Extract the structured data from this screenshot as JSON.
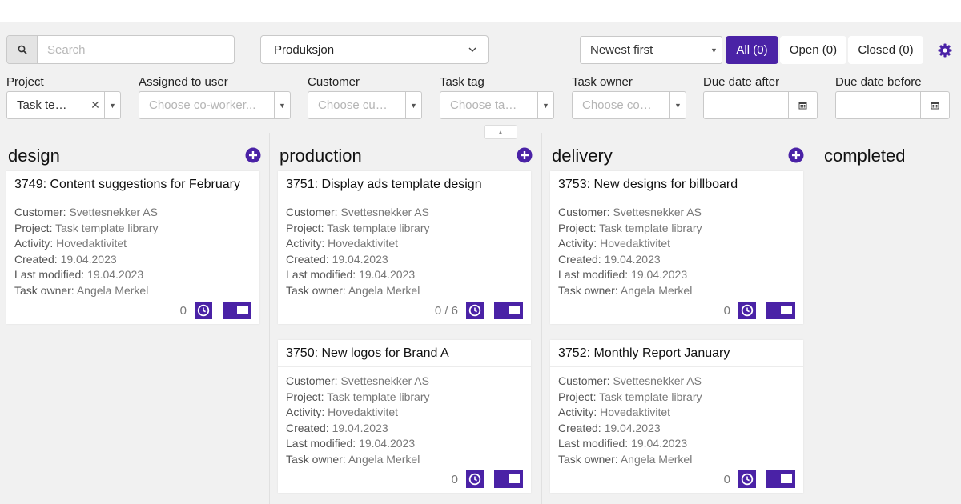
{
  "toolbar": {
    "search_placeholder": "Search",
    "board": "Produksjon",
    "sort": "Newest first",
    "filters": {
      "all": "All (0)",
      "open": "Open (0)",
      "closed": "Closed (0)"
    }
  },
  "filters": {
    "project": {
      "label": "Project",
      "value": "Task te…"
    },
    "assigned": {
      "label": "Assigned to user",
      "placeholder": "Choose co-worker..."
    },
    "customer": {
      "label": "Customer",
      "placeholder": "Choose cu…"
    },
    "task_tag": {
      "label": "Task tag",
      "placeholder": "Choose ta…"
    },
    "task_owner": {
      "label": "Task owner",
      "placeholder": "Choose co…"
    },
    "due_after": {
      "label": "Due date after"
    },
    "due_before": {
      "label": "Due date before"
    }
  },
  "meta_keys": {
    "customer": "Customer:",
    "project": "Project:",
    "activity": "Activity:",
    "created": "Created:",
    "modified": "Last modified:",
    "owner": "Task owner:"
  },
  "columns": [
    {
      "title": "design",
      "cards": [
        {
          "title": "3749: Content suggestions for February",
          "customer": "Svettesnekker AS",
          "project": "Task template library",
          "activity": "Hovedaktivitet",
          "created": "19.04.2023",
          "modified": "19.04.2023",
          "owner": "Angela Merkel",
          "count": "0"
        }
      ]
    },
    {
      "title": "production",
      "cards": [
        {
          "title": "3751: Display ads template design",
          "customer": "Svettesnekker AS",
          "project": "Task template library",
          "activity": "Hovedaktivitet",
          "created": "19.04.2023",
          "modified": "19.04.2023",
          "owner": "Angela Merkel",
          "count": "0 / 6"
        },
        {
          "title": "3750: New logos for Brand A",
          "customer": "Svettesnekker AS",
          "project": "Task template library",
          "activity": "Hovedaktivitet",
          "created": "19.04.2023",
          "modified": "19.04.2023",
          "owner": "Angela Merkel",
          "count": "0"
        }
      ]
    },
    {
      "title": "delivery",
      "cards": [
        {
          "title": "3753: New designs for billboard",
          "customer": "Svettesnekker AS",
          "project": "Task template library",
          "activity": "Hovedaktivitet",
          "created": "19.04.2023",
          "modified": "19.04.2023",
          "owner": "Angela Merkel",
          "count": "0"
        },
        {
          "title": "3752: Monthly Report January",
          "customer": "Svettesnekker AS",
          "project": "Task template library",
          "activity": "Hovedaktivitet",
          "created": "19.04.2023",
          "modified": "19.04.2023",
          "owner": "Angela Merkel",
          "count": "0"
        }
      ]
    },
    {
      "title": "completed",
      "cards": []
    }
  ],
  "colors": {
    "accent": "#4a22a6",
    "background": "#f1f1f1"
  }
}
